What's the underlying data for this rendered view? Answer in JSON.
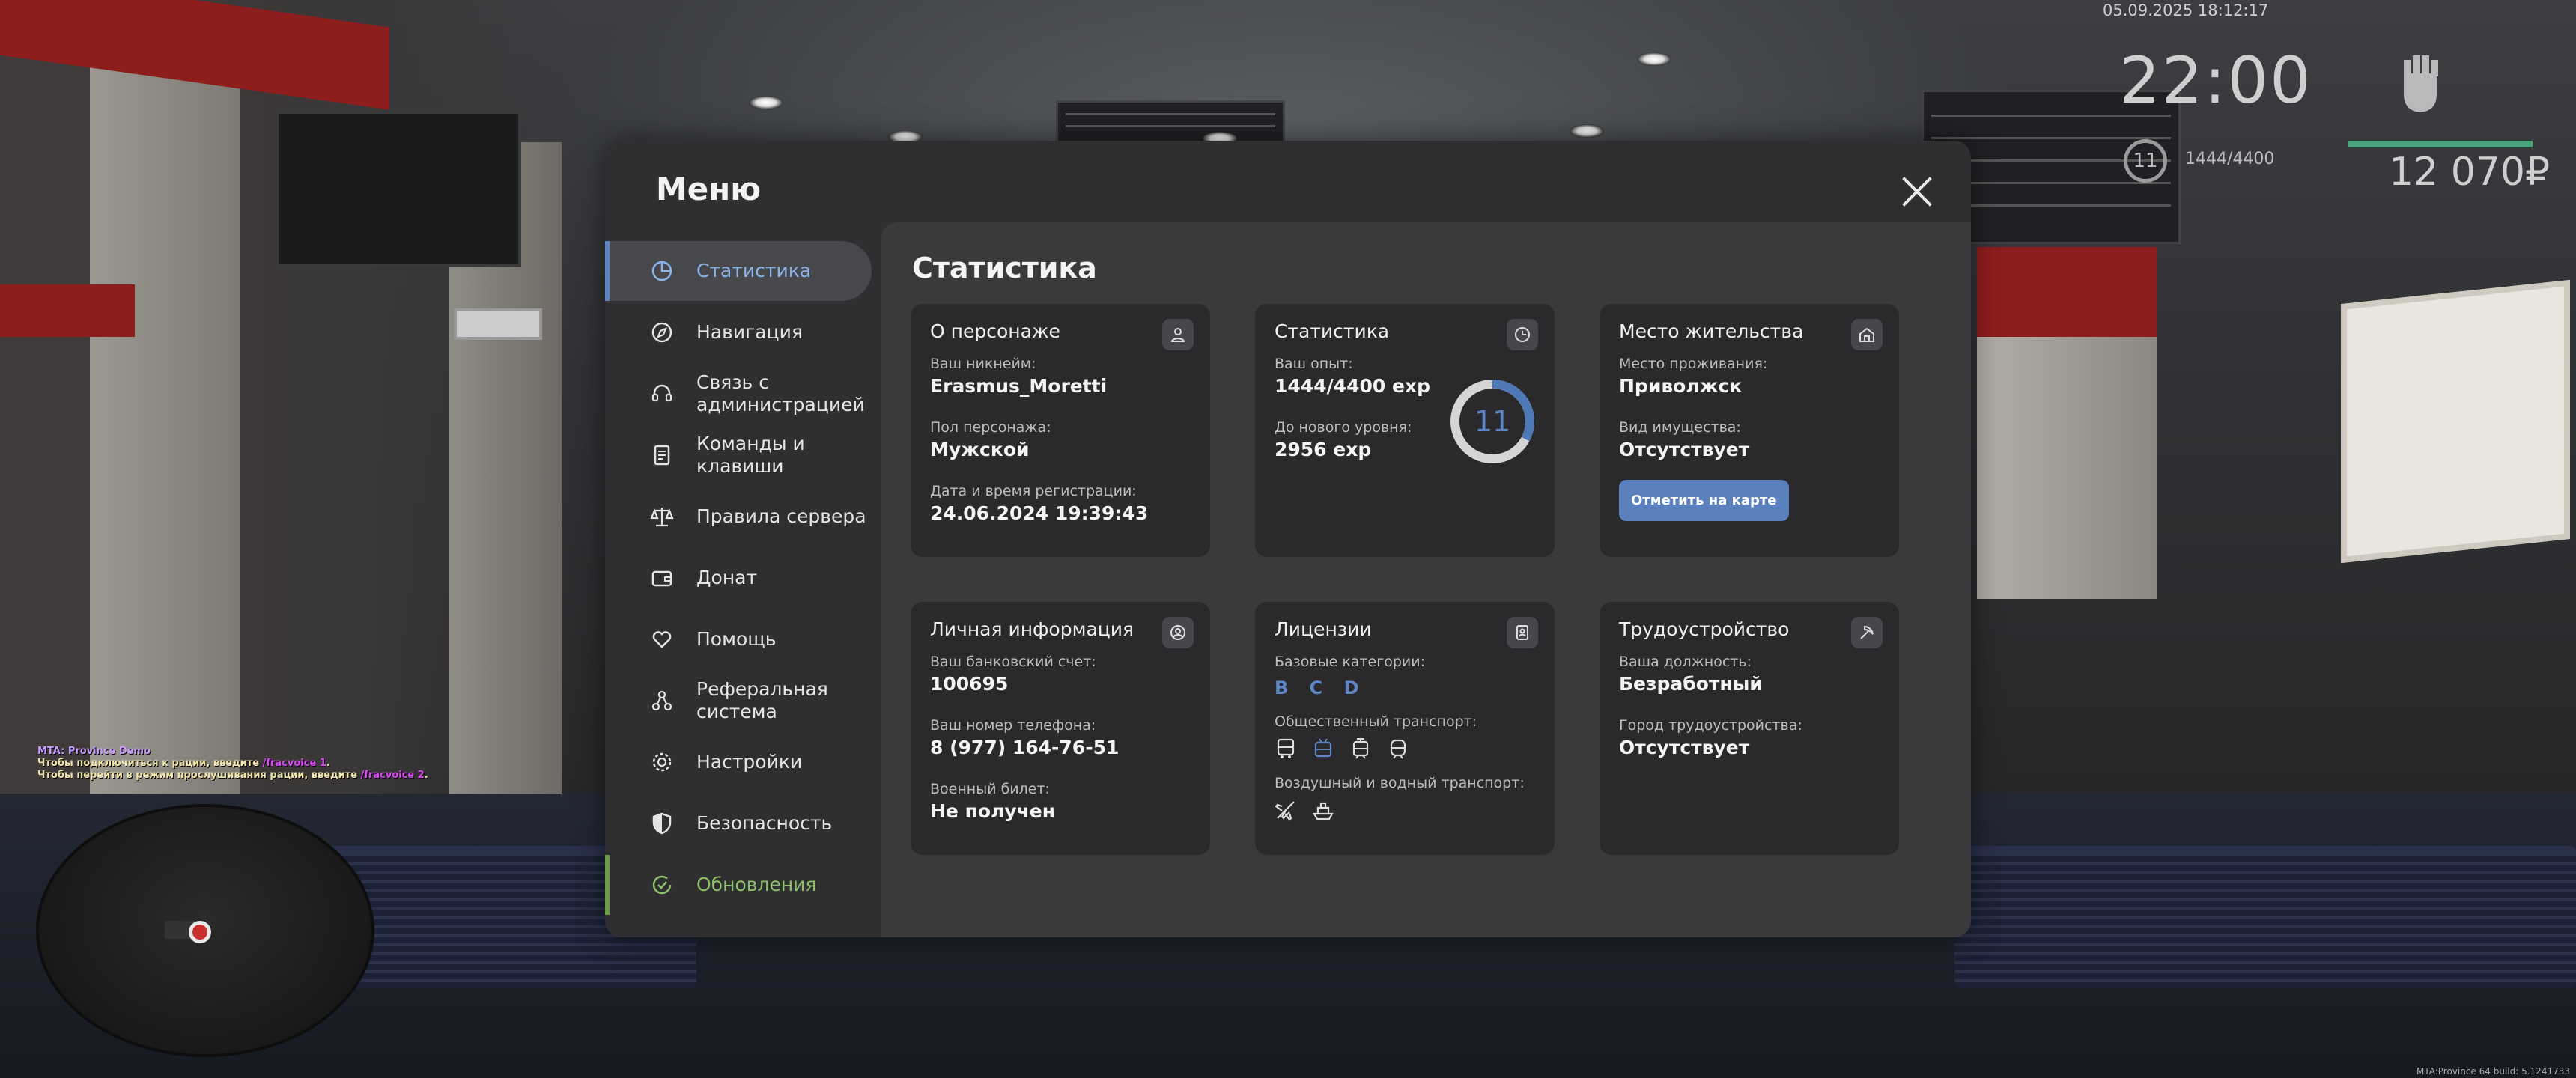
{
  "hud": {
    "datetime": "05.09.2025 18:12:17",
    "time": "22:00",
    "money": "12 070₽",
    "level": "11",
    "exp": "1444/4400"
  },
  "chat": {
    "line1": "MTA: Province Demo",
    "line2_prefix": "Чтобы подключиться к рации, введите",
    "line2_cmd": "/fracvoice 1",
    "line3_prefix": "Чтобы перейти в режим прослушивания рации, введите",
    "line3_cmd": "/fracvoice 2"
  },
  "build": "MTA:Province 64 build: 5.1241733",
  "menu": {
    "title": "Меню",
    "content_title": "Статистика",
    "sidebar": [
      {
        "label": "Статистика",
        "icon": "pie-chart-icon",
        "active": true
      },
      {
        "label": "Навигация",
        "icon": "compass-icon"
      },
      {
        "label": "Связь с администрацией",
        "icon": "headset-icon"
      },
      {
        "label": "Команды и клавиши",
        "icon": "document-icon"
      },
      {
        "label": "Правила сервера",
        "icon": "scales-icon"
      },
      {
        "label": "Донат",
        "icon": "wallet-icon"
      },
      {
        "label": "Помощь",
        "icon": "heart-hand-icon"
      },
      {
        "label": "Реферальная система",
        "icon": "referral-icon"
      },
      {
        "label": "Настройки",
        "icon": "gear-icon"
      },
      {
        "label": "Безопасность",
        "icon": "shield-icon"
      },
      {
        "label": "Обновления",
        "icon": "refresh-check-icon"
      }
    ],
    "cards": {
      "character": {
        "title": "О персонаже",
        "nick_label": "Ваш никнейм:",
        "nick": "Erasmus_Moretti",
        "gender_label": "Пол персонажа:",
        "gender": "Мужской",
        "reg_label": "Дата и время регистрации:",
        "reg": "24.06.2024 19:39:43"
      },
      "stats": {
        "title": "Статистика",
        "exp_label": "Ваш опыт:",
        "exp": "1444/4400 exp",
        "next_label": "До нового уровня:",
        "next": "2956 exp",
        "level": "11",
        "progress": 0.328
      },
      "residence": {
        "title": "Место жительства",
        "place_label": "Место проживания:",
        "place": "Приволжск",
        "property_label": "Вид имущества:",
        "property": "Отсутствует",
        "button": "Отметить на карте"
      },
      "personal": {
        "title": "Личная информация",
        "bank_label": "Ваш банковский счет:",
        "bank": "100695",
        "phone_label": "Ваш номер телефона:",
        "phone": "8 (977) 164-76-51",
        "military_label": "Военный билет:",
        "military": "Не получен"
      },
      "licenses": {
        "title": "Лицензии",
        "base_label": "Базовые категории:",
        "base_cats": "B C D",
        "public_label": "Общественный транспорт:",
        "public_icons": [
          "bus-icon",
          "trolleybus-icon",
          "tram-icon",
          "metro-icon"
        ],
        "air_label": "Воздушный и водный транспорт:",
        "air_icons": [
          "airplane-icon",
          "boat-icon"
        ]
      },
      "job": {
        "title": "Трудоустройство",
        "position_label": "Ваша должность:",
        "position": "Безработный",
        "city_label": "Город трудоустройства:",
        "city": "Отсутствует"
      }
    }
  },
  "colors": {
    "accent": "#5b86c5",
    "update": "#8cc06a",
    "hud_bar": "#4aa37a"
  }
}
